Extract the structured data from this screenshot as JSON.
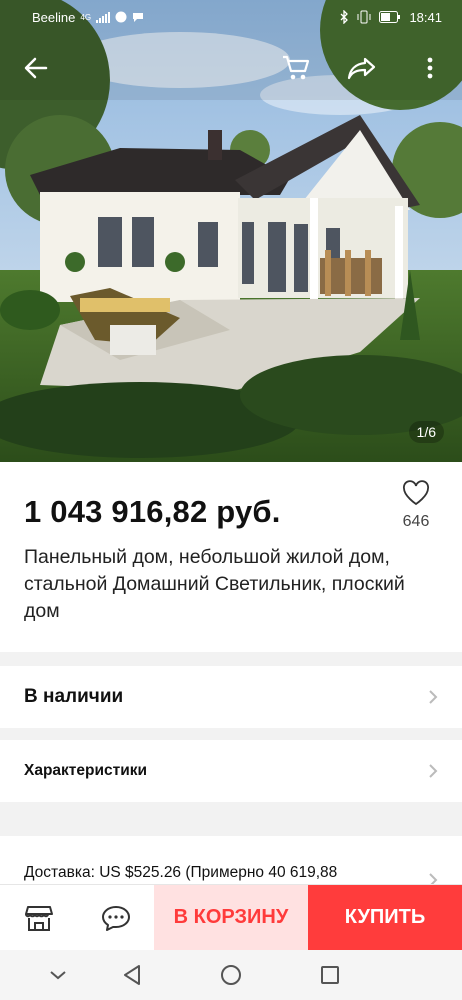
{
  "status_bar": {
    "carrier": "Beeline",
    "signal": "4G",
    "time": "18:41"
  },
  "gallery": {
    "counter": "1/6"
  },
  "product": {
    "price": "1 043 916,82 руб.",
    "likes": "646",
    "title": "Панельный дом, небольшой жилой дом, стальной Домашний Светильник, плоский дом"
  },
  "rows": {
    "stock": "В наличии",
    "specs": "Характеристики",
    "shipping_label": "Доставка:",
    "shipping_value": "US $525.26 (Примерно 40 619,88"
  },
  "actions": {
    "add_to_cart": "В КОРЗИНУ",
    "buy": "КУПИТЬ"
  },
  "icons": {
    "back": "back-arrow-icon",
    "cart": "cart-icon",
    "share": "share-icon",
    "more": "more-icon",
    "like": "heart-icon",
    "store": "store-icon",
    "chat": "chat-icon"
  },
  "colors": {
    "accent": "#ff3c3c",
    "accent_light": "#ffe1e1"
  }
}
